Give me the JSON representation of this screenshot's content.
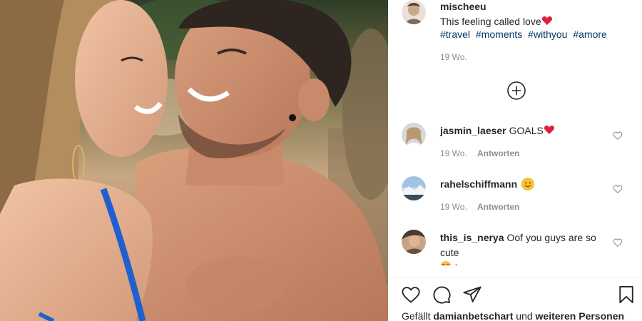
{
  "post": {
    "author": "mischeeu",
    "caption_text": "This feeling called love",
    "caption_emoji": "red-heart-icon",
    "hashtags": [
      "#travel",
      "#moments",
      "#withyou",
      "#amore"
    ],
    "time": "19 Wo."
  },
  "load_more_icon": "plus-circle-icon",
  "comments": [
    {
      "user": "jasmin_laeser",
      "text": "GOALS",
      "emoji": "red-heart-icon",
      "time": "19 Wo.",
      "reply": "Antworten"
    },
    {
      "user": "rahelschiffmann",
      "text": "",
      "emoji": "smiling-face-icon",
      "time": "19 Wo.",
      "reply": "Antworten"
    },
    {
      "user": "this_is_nerya",
      "text": "Oof you guys are so cute",
      "emoji": "heart-eyes-and-fire-icon",
      "time": "",
      "reply": ""
    }
  ],
  "actions": {
    "like_icon": "heart-outline-icon",
    "comment_icon": "comment-bubble-icon",
    "share_icon": "paper-plane-icon",
    "save_icon": "bookmark-icon"
  },
  "likes": {
    "prefix": "Gefällt",
    "user": "damianbetschart",
    "joiner": "und",
    "others": "weiteren Personen"
  },
  "colors": {
    "text": "#262626",
    "secondary": "#8e8e8e",
    "hashtag": "#00376b",
    "heart": "#ed4956"
  }
}
